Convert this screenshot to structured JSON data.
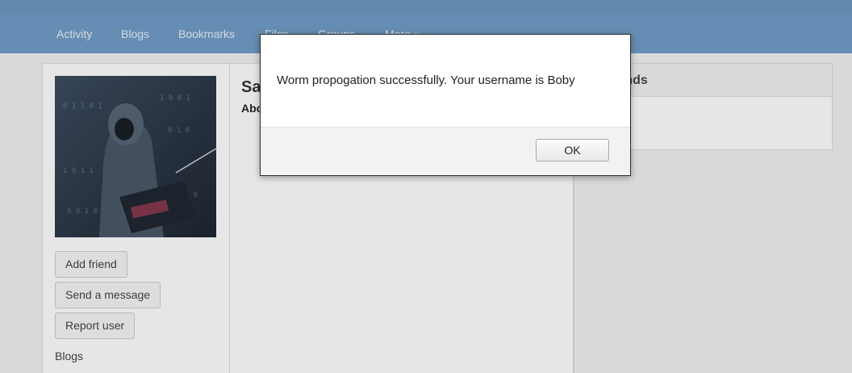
{
  "nav": {
    "items": [
      {
        "label": "Activity"
      },
      {
        "label": "Blogs"
      },
      {
        "label": "Bookmarks"
      },
      {
        "label": "Files"
      },
      {
        "label": "Groups"
      },
      {
        "label": "More »"
      }
    ]
  },
  "sidebar": {
    "add_friend_label": "Add friend",
    "send_message_label": "Send a message",
    "report_user_label": "Report user",
    "blogs_label": "Blogs"
  },
  "profile": {
    "name": "Sa",
    "about_label": "Abo"
  },
  "friends": {
    "title": "Friends"
  },
  "dialog": {
    "message": "Worm propogation successfully. Your username is Boby",
    "ok_label": "OK"
  },
  "colors": {
    "nav_background": "#6f99c3",
    "page_background": "#ececec",
    "dialog_background": "#ffffff"
  }
}
